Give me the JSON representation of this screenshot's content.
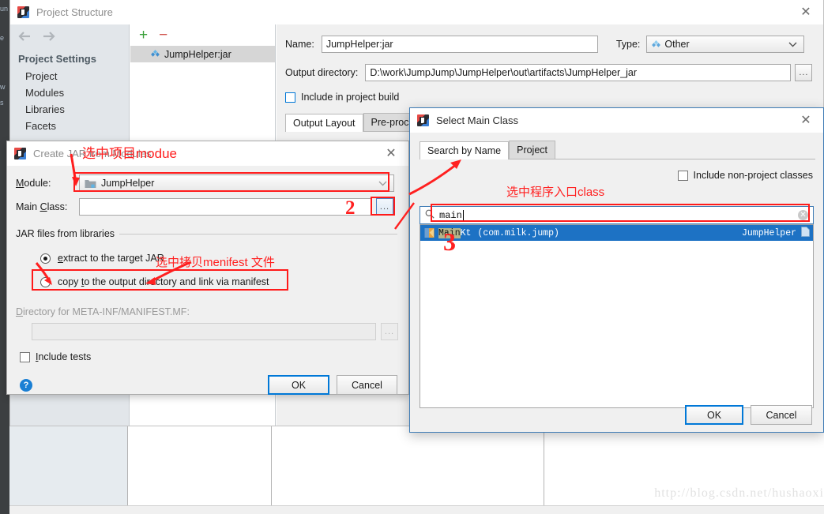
{
  "ide_strip": {
    "fragments": [
      "un",
      "e",
      "w",
      "s"
    ]
  },
  "watermark": {
    "text": "http://blog.csdn.net/hushaoxi"
  },
  "project_structure": {
    "title": "Project Structure",
    "close_label": "✕",
    "nav": {
      "back": "back-arrow",
      "forward": "forward-arrow"
    },
    "sidebar": {
      "section_title": "Project Settings",
      "items": [
        {
          "label": "Project"
        },
        {
          "label": "Modules"
        },
        {
          "label": "Libraries"
        },
        {
          "label": "Facets"
        }
      ]
    },
    "artifacts": {
      "add_label": "+",
      "remove_label": "−",
      "rows": [
        {
          "label": "JumpHelper:jar",
          "icon": "artifact-diamond-icon"
        }
      ]
    },
    "detail": {
      "name_label": "Name:",
      "name_value": "JumpHelper:jar",
      "type_label": "Type:",
      "type_value": "Other",
      "output_dir_label": "Output directory:",
      "output_dir_value": "D:\\work\\JumpJump\\JumpHelper\\out\\artifacts\\JumpHelper_jar",
      "browse_label": "...",
      "include_in_build_label": "Include in project build",
      "tabs": [
        {
          "label": "Output Layout",
          "active": true
        },
        {
          "label": "Pre-processi",
          "active": false
        }
      ]
    }
  },
  "create_jar": {
    "title": "Create JAR from Modules",
    "close_label": "✕",
    "module_label": "Module:",
    "module_value": "JumpHelper",
    "main_class_label": "Main Class:",
    "main_class_value": "",
    "main_class_browse_label": "...",
    "group_label": "JAR files from libraries",
    "radio_extract_label": "extract to the target JAR",
    "radio_copy_label": "copy to the output directory and link via manifest",
    "manifest_dir_label": "Directory for META-INF/MANIFEST.MF:",
    "manifest_dir_value": "",
    "manifest_browse_label": "...",
    "include_tests_label": "Include tests",
    "help_label": "?",
    "ok_label": "OK",
    "cancel_label": "Cancel"
  },
  "select_main_class": {
    "title": "Select Main Class",
    "close_label": "✕",
    "tabs": [
      {
        "label": "Search by Name",
        "active": true
      },
      {
        "label": "Project",
        "active": false
      }
    ],
    "include_non_project_label": "Include non-project classes",
    "search_value": "main",
    "search_icon": "magnifier-icon",
    "clear_label": "✕",
    "results": [
      {
        "match": "Main",
        "rest": "Kt",
        "package": "(com.milk.jump)",
        "module": "JumpHelper"
      }
    ],
    "ok_label": "OK",
    "cancel_label": "Cancel"
  },
  "annotations": {
    "note_module": "选中项目modue",
    "note_manifest": "选中拷贝menifest 文件",
    "note_mainclass": "选中程序入口class",
    "num_2": "2",
    "num_3": "3"
  }
}
